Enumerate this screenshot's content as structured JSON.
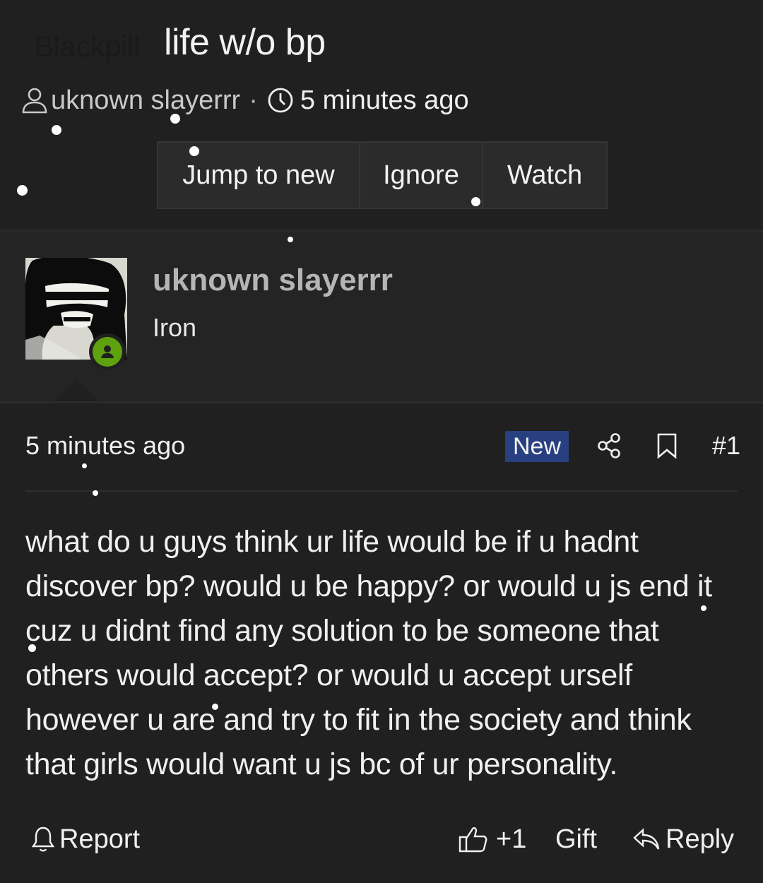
{
  "thread": {
    "prefix": "Blackpill",
    "title": "life w/o bp",
    "author": "uknown slayerrr",
    "separator": "·",
    "time": "5 minutes ago"
  },
  "actions": {
    "jump_label": "Jump to new",
    "ignore_label": "Ignore",
    "watch_label": "Watch"
  },
  "user": {
    "name": "uknown slayerrr",
    "title": "Iron",
    "status_color": "#5ea20f"
  },
  "post": {
    "time": "5 minutes ago",
    "badge": "New",
    "badge_color": "#283f80",
    "number": "#1",
    "body": "what do u guys think ur life would be if u hadnt discover bp? would u be happy? or would u js end it cuz u didnt find any solution to be someone that others would accept? or would u accept urself however u are and try to fit in the society and think that girls would want u js bc of ur personality."
  },
  "footer": {
    "report_label": "Report",
    "like_label": "+1",
    "gift_label": "Gift",
    "reply_label": "Reply"
  },
  "icons": {
    "author": "user-icon",
    "time": "clock-icon",
    "share": "share-icon",
    "bookmark": "bookmark-icon",
    "report": "bell-icon",
    "like": "thumbs-up-icon",
    "reply": "reply-icon",
    "online": "online-status-icon"
  }
}
